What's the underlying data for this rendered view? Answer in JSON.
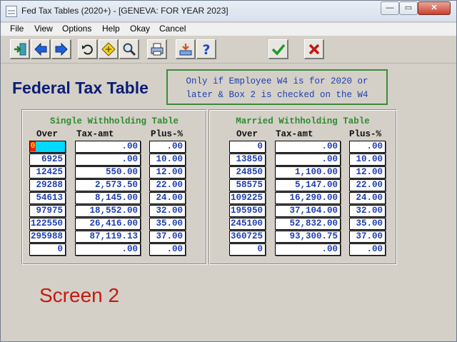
{
  "window": {
    "title": "Fed Tax Tables (2020+) - [GENEVA: FOR YEAR 2023]",
    "controls": {
      "minimize": "—",
      "maximize": "▭",
      "close": "✕"
    }
  },
  "menu": [
    "File",
    "View",
    "Options",
    "Help",
    "Okay",
    "Cancel"
  ],
  "toolbar": {
    "buttons": [
      "exit-icon",
      "back-arrow-icon",
      "forward-arrow-icon",
      "undo-icon",
      "diamond-icon",
      "search-icon",
      "print-icon",
      "import-icon",
      "help-icon",
      "okay-check-icon",
      "cancel-x-icon"
    ]
  },
  "page": {
    "title": "Federal Tax Table",
    "note_line1": "Only if Employee W4 is for 2020 or",
    "note_line2": "later & Box 2 is checked on the W4",
    "screen_label": "Screen 2"
  },
  "single": {
    "heading": "Single Withholding Table",
    "col_over": "Over",
    "col_tax": "Tax-amt",
    "col_plus": "Plus-%",
    "active_cursor": "0",
    "rows": [
      {
        "over": "",
        "tax": ".00",
        "plus": ".00"
      },
      {
        "over": "6925",
        "tax": ".00",
        "plus": "10.00"
      },
      {
        "over": "12425",
        "tax": "550.00",
        "plus": "12.00"
      },
      {
        "over": "29288",
        "tax": "2,573.50",
        "plus": "22.00"
      },
      {
        "over": "54613",
        "tax": "8,145.00",
        "plus": "24.00"
      },
      {
        "over": "97975",
        "tax": "18,552.00",
        "plus": "32.00"
      },
      {
        "over": "122550",
        "tax": "26,416.00",
        "plus": "35.00"
      },
      {
        "over": "295988",
        "tax": "87,119.13",
        "plus": "37.00"
      },
      {
        "over": "0",
        "tax": ".00",
        "plus": ".00"
      }
    ]
  },
  "married": {
    "heading": "Married Withholding Table",
    "col_over": "Over",
    "col_tax": "Tax-amt",
    "col_plus": "Plus-%",
    "rows": [
      {
        "over": "0",
        "tax": ".00",
        "plus": ".00"
      },
      {
        "over": "13850",
        "tax": ".00",
        "plus": "10.00"
      },
      {
        "over": "24850",
        "tax": "1,100.00",
        "plus": "12.00"
      },
      {
        "over": "58575",
        "tax": "5,147.00",
        "plus": "22.00"
      },
      {
        "over": "109225",
        "tax": "16,290.00",
        "plus": "24.00"
      },
      {
        "over": "195950",
        "tax": "37,104.00",
        "plus": "32.00"
      },
      {
        "over": "245100",
        "tax": "52,832.00",
        "plus": "35.00"
      },
      {
        "over": "360725",
        "tax": "93,300.75",
        "plus": "37.00"
      },
      {
        "over": "0",
        "tax": ".00",
        "plus": ".00"
      }
    ]
  },
  "colors": {
    "title_blue": "#0c1d74",
    "value_blue": "#1e3eb0",
    "heading_green": "#2e8b2e",
    "screen_red": "#c31a10",
    "active_cell": "#00d8ff"
  }
}
